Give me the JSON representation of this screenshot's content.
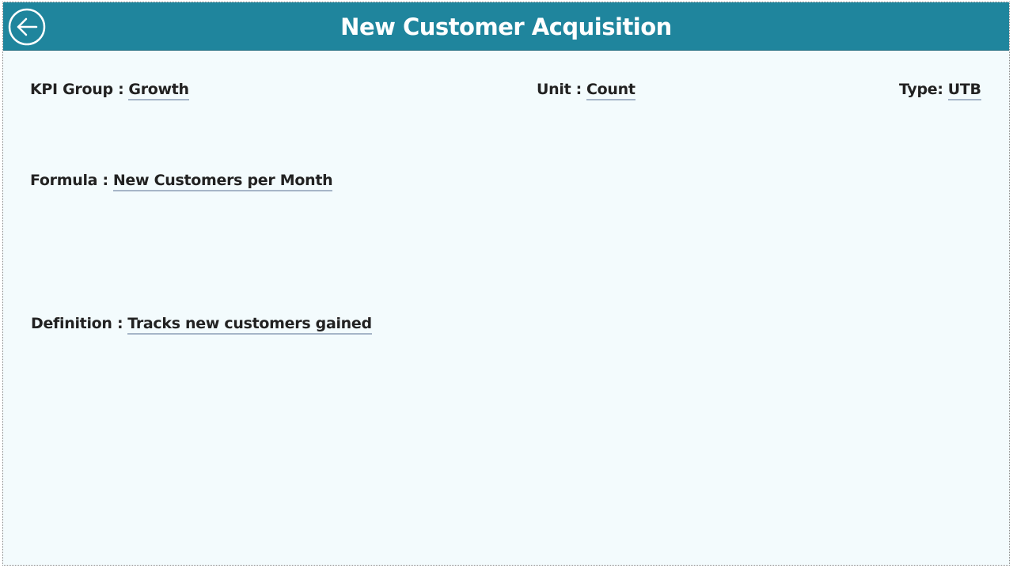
{
  "header": {
    "title": "New Customer Acquisition",
    "back_icon": "arrow-left-circle-icon",
    "background_color": "#1f859d"
  },
  "fields": {
    "kpi_group": {
      "label": "KPI Group :",
      "value": "Growth"
    },
    "unit": {
      "label": "Unit :",
      "value": "Count"
    },
    "type": {
      "label": "Type:",
      "value": "UTB"
    },
    "formula": {
      "label": "Formula :",
      "value": "New Customers per Month"
    },
    "definition": {
      "label": "Definition :",
      "value": "Tracks new customers gained"
    }
  },
  "colors": {
    "page_background": "#f3fbfd",
    "text": "#222222",
    "underline": "#a6b5c8"
  }
}
